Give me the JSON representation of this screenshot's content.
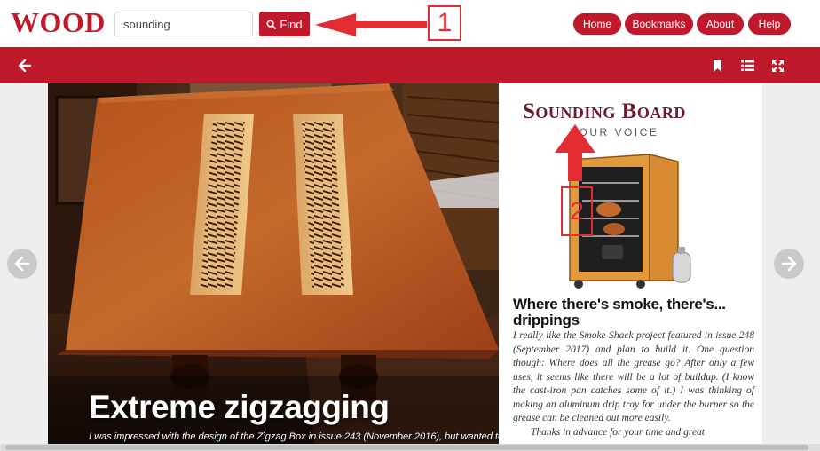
{
  "header": {
    "logo": "WOOD",
    "search_value": "sounding",
    "find_label": "Find",
    "nav": [
      "Home",
      "Bookmarks",
      "About",
      "Help"
    ]
  },
  "toolbar": {
    "icons": [
      "back-arrow-icon",
      "bookmark-icon",
      "list-icon",
      "fullscreen-icon"
    ]
  },
  "annotations": {
    "first": "1",
    "second": "2"
  },
  "left_page": {
    "headline": "Extreme zigzagging",
    "subline": "I was impressed with the design of the Zigzag Box in issue 243 (November 2016), but wanted to try"
  },
  "right_page": {
    "title": "Sounding Board",
    "subtitle": "YOUR VOICE",
    "article_title": "Where there's smoke, there's... drippings",
    "paragraph1": "I really like the Smoke Shack project featured in issue 248 (September 2017) and plan to build it. One question though: Where does all the grease go? After only a few uses, it seems like there will be a lot of buildup. (I know the cast-iron pan catches some of it.) I was thinking of making an aluminum drip tray for under the burner so the grease can be cleaned out more easily.",
    "paragraph2": "Thanks in advance for your time and great"
  },
  "colors": {
    "brand_red": "#c0192b",
    "annotation_red": "#e32b32"
  }
}
